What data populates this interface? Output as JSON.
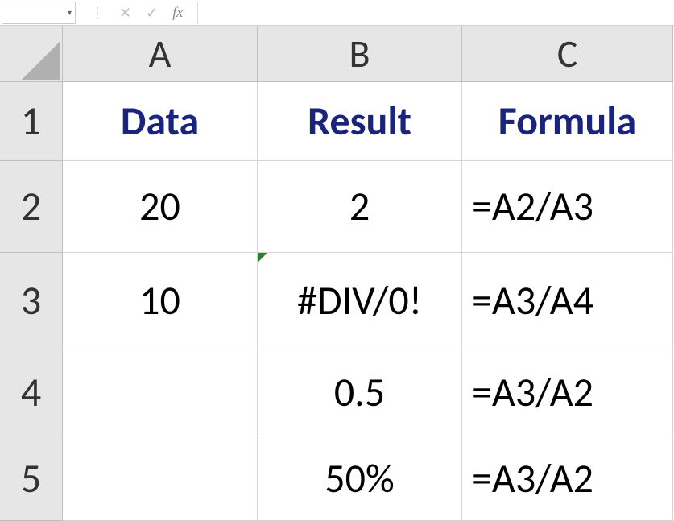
{
  "formula_bar": {
    "fx_label": "fx",
    "cancel_icon": "✕",
    "enter_icon": "✓"
  },
  "columns": [
    "A",
    "B",
    "C"
  ],
  "rows": [
    "1",
    "2",
    "3",
    "4",
    "5"
  ],
  "headers": {
    "A": "Data",
    "B": "Result",
    "C": "Formula"
  },
  "cells": {
    "A2": "20",
    "B2": "2",
    "C2": "=A2/A3",
    "A3": "10",
    "B3": "#DIV/0!",
    "C3": "=A3/A4",
    "A4": "",
    "B4": "0.5",
    "C4": "=A3/A2",
    "A5": "",
    "B5": "50%",
    "C5": "=A3/A2"
  }
}
